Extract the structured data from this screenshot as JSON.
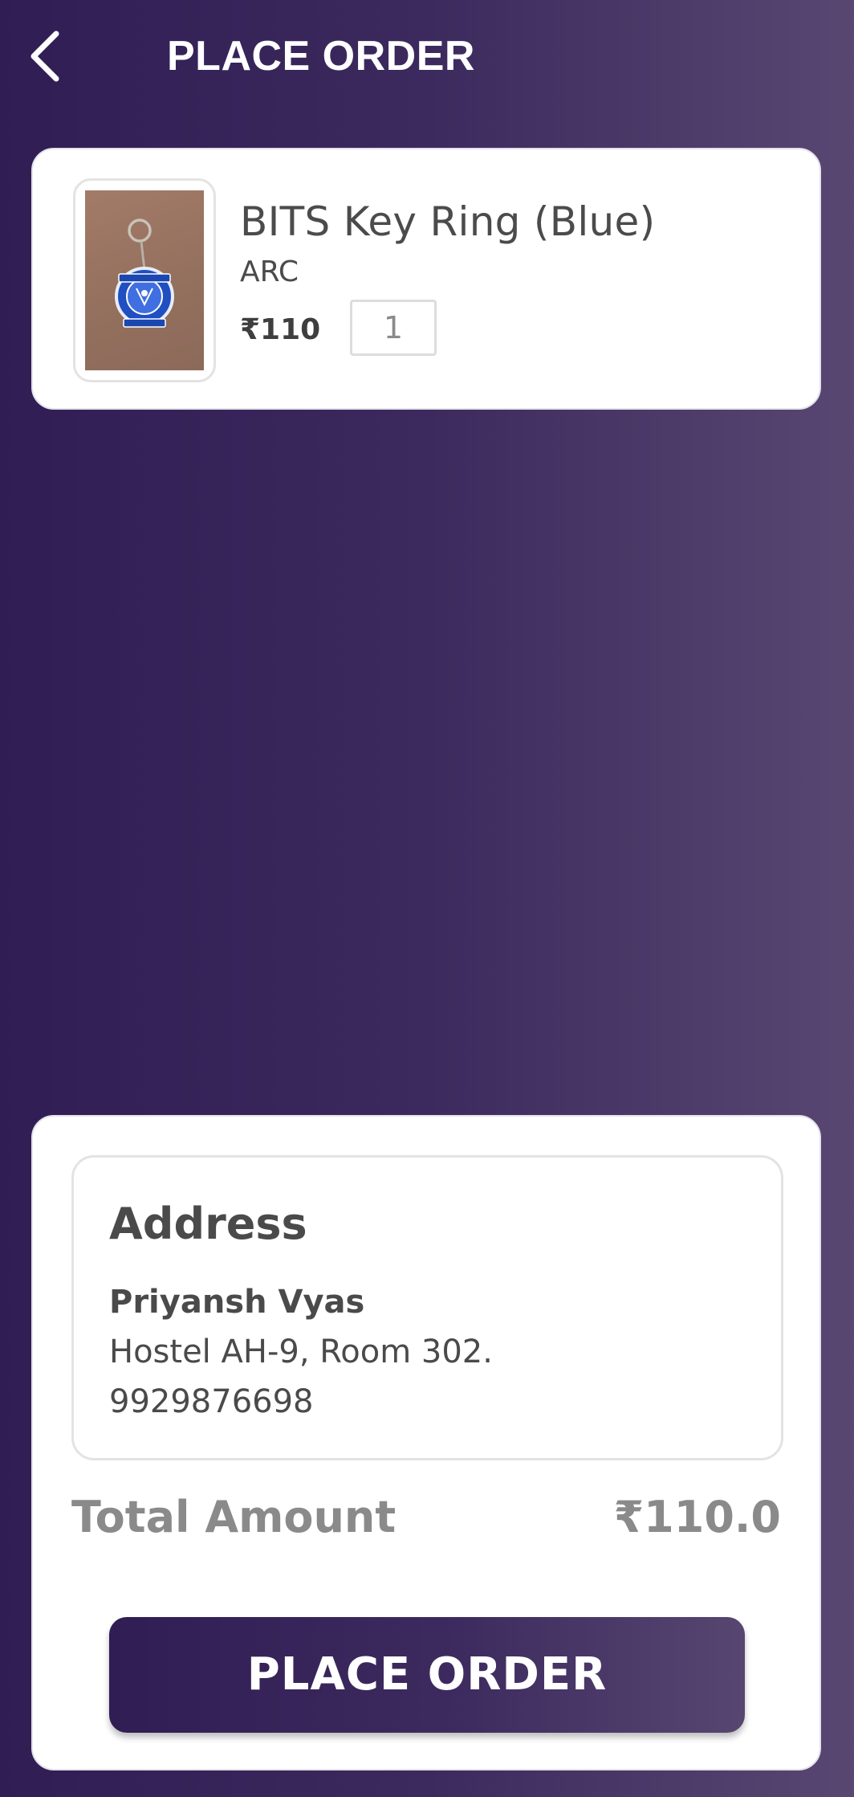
{
  "header": {
    "title": "PLACE ORDER",
    "back_icon": "chevron-left-icon"
  },
  "product": {
    "name": "BITS Key Ring (Blue)",
    "seller": "ARC",
    "price": "₹110",
    "quantity": "1",
    "image_icon": "keyring-photo"
  },
  "address": {
    "heading": "Address",
    "name": "Priyansh Vyas",
    "line": "Hostel AH-9, Room 302.",
    "phone": "9929876698"
  },
  "total": {
    "label": "Total Amount",
    "value": "₹110.0"
  },
  "action": {
    "place_order_label": "PLACE ORDER"
  },
  "colors": {
    "background_start": "#2f1d54",
    "background_end": "#584771",
    "card": "#ffffff",
    "text_dark": "#4a4a4a",
    "text_muted": "#8a8a8a",
    "keyring_blue": "#1f4fc1"
  }
}
